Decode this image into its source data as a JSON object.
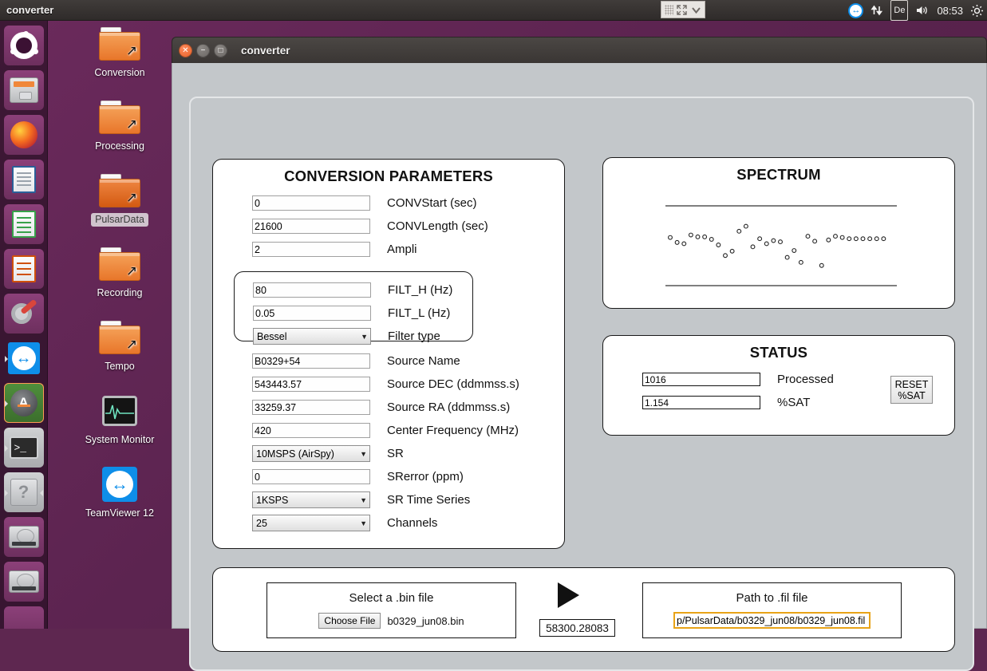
{
  "top_panel": {
    "app_title": "converter",
    "window_controls_icons": [
      "dot-grid-icon",
      "expand-icon",
      "chevron-down-icon"
    ],
    "tray": {
      "teamviewer_icon": "teamviewer-icon",
      "network_icon": "network-updown-icon",
      "keyboard_layout": "De",
      "volume_icon": "volume-icon",
      "clock": "08:53",
      "system_icon": "gear-cog-icon"
    }
  },
  "launcher": {
    "items": [
      {
        "name": "ubuntu-dash",
        "icon": "ubuntu-logo-icon"
      },
      {
        "name": "files",
        "icon": "file-manager-icon"
      },
      {
        "name": "firefox",
        "icon": "firefox-icon"
      },
      {
        "name": "libreoffice-writer",
        "icon": "libreoffice-writer-icon"
      },
      {
        "name": "libreoffice-calc",
        "icon": "libreoffice-calc-icon"
      },
      {
        "name": "libreoffice-impress",
        "icon": "libreoffice-impress-icon"
      },
      {
        "name": "system-settings",
        "icon": "gear-wrench-icon"
      },
      {
        "name": "teamviewer",
        "icon": "teamviewer-icon"
      },
      {
        "name": "software-updater",
        "icon": "software-updater-icon"
      },
      {
        "name": "terminal",
        "icon": "terminal-icon"
      },
      {
        "name": "help",
        "icon": "question-mark-icon"
      },
      {
        "name": "disk-1",
        "icon": "hard-disk-icon"
      },
      {
        "name": "disk-2",
        "icon": "hard-disk-icon"
      }
    ]
  },
  "desktop_icons": [
    {
      "label": "Conversion",
      "icon": "folder-shortcut-icon",
      "selected": false
    },
    {
      "label": "Processing",
      "icon": "folder-shortcut-icon",
      "selected": false
    },
    {
      "label": "PulsarData",
      "icon": "folder-shortcut-icon",
      "selected": true
    },
    {
      "label": "Recording",
      "icon": "folder-shortcut-icon",
      "selected": false
    },
    {
      "label": "Tempo",
      "icon": "folder-shortcut-icon",
      "selected": false
    },
    {
      "label": "System Monitor",
      "icon": "system-monitor-icon",
      "selected": false
    },
    {
      "label": "TeamViewer 12",
      "icon": "teamviewer-icon",
      "selected": false
    }
  ],
  "window": {
    "title": "converter",
    "buttons": {
      "close": "close-icon",
      "minimize": "minimize-icon",
      "maximize": "maximize-icon"
    }
  },
  "params": {
    "title": "CONVERSION PARAMETERS",
    "fields": [
      {
        "name": "convstart",
        "value": "0",
        "label": "CONVStart (sec)",
        "type": "text"
      },
      {
        "name": "convlength",
        "value": "21600",
        "label": "CONVLength (sec)",
        "type": "text"
      },
      {
        "name": "ampli",
        "value": "2",
        "label": "Ampli",
        "type": "text"
      }
    ],
    "filter_group": [
      {
        "name": "filt-h",
        "value": "80",
        "label": "FILT_H (Hz)",
        "type": "text"
      },
      {
        "name": "filt-l",
        "value": "0.05",
        "label": "FILT_L (Hz)",
        "type": "text"
      },
      {
        "name": "filter-type",
        "value": "Bessel",
        "label": "Filter type",
        "type": "select"
      }
    ],
    "fields2": [
      {
        "name": "source-name",
        "value": "B0329+54",
        "label": "Source Name",
        "type": "text"
      },
      {
        "name": "source-dec",
        "value": "543443.57",
        "label": "Source DEC (ddmmss.s)",
        "type": "text"
      },
      {
        "name": "source-ra",
        "value": "33259.37",
        "label": "Source RA (ddmmss.s)",
        "type": "text"
      },
      {
        "name": "center-frequency",
        "value": "420",
        "label": "Center Frequency (MHz)",
        "type": "text"
      },
      {
        "name": "sr",
        "value": "10MSPS (AirSpy)",
        "label": "SR",
        "type": "select"
      },
      {
        "name": "srerror",
        "value": "0",
        "label": "SRerror (ppm)",
        "type": "text"
      },
      {
        "name": "sr-time-series",
        "value": "1KSPS",
        "label": "SR Time Series",
        "type": "select"
      },
      {
        "name": "channels",
        "value": "25",
        "label": "Channels",
        "type": "select"
      }
    ]
  },
  "spectrum": {
    "title": "SPECTRUM"
  },
  "chart_data": {
    "type": "scatter",
    "title": "SPECTRUM",
    "xlabel": "",
    "ylabel": "",
    "grid": false,
    "legend": null,
    "marker": "open-circle",
    "axis_lines": [
      "top-rule",
      "bottom-rule"
    ],
    "xlim": [
      0,
      32
    ],
    "ylim": [
      0,
      1
    ],
    "x": [
      0,
      1,
      2,
      3,
      4,
      5,
      6,
      7,
      8,
      9,
      10,
      11,
      12,
      13,
      14,
      15,
      16,
      17,
      18,
      19,
      20,
      21,
      22,
      23,
      24,
      25,
      26,
      27,
      28,
      29,
      30,
      31
    ],
    "y": [
      0.62,
      0.54,
      0.52,
      0.66,
      0.63,
      0.63,
      0.59,
      0.5,
      0.33,
      0.4,
      0.72,
      0.8,
      0.47,
      0.6,
      0.52,
      0.57,
      0.55,
      0.3,
      0.41,
      0.22,
      0.64,
      0.56,
      0.17,
      0.58,
      0.64,
      0.62,
      0.6,
      0.6,
      0.6,
      0.6,
      0.6,
      0.6
    ]
  },
  "status": {
    "title": "STATUS",
    "rows": [
      {
        "name": "processed",
        "value": "1016",
        "label": "Processed"
      },
      {
        "name": "sat",
        "value": "1.154",
        "label": "%SAT"
      }
    ],
    "reset_button": {
      "line1": "RESET",
      "line2": "%SAT"
    }
  },
  "files": {
    "bin": {
      "title": "Select a .bin file",
      "choose_label": "Choose File",
      "file_name": "b0329_jun08.bin"
    },
    "play_icon": "play-triangle-icon",
    "mjd": "58300.28083",
    "fil": {
      "title": "Path to .fil file",
      "path": "p/PulsarData/b0329_jun08/b0329_jun08.fil"
    }
  },
  "colors": {
    "accent_orange": "#e8762a",
    "teamviewer_blue": "#0e8ee9",
    "focus_border": "#e8a317",
    "desktop_purple": "#5c2450",
    "window_chrome": "#3a3634"
  }
}
